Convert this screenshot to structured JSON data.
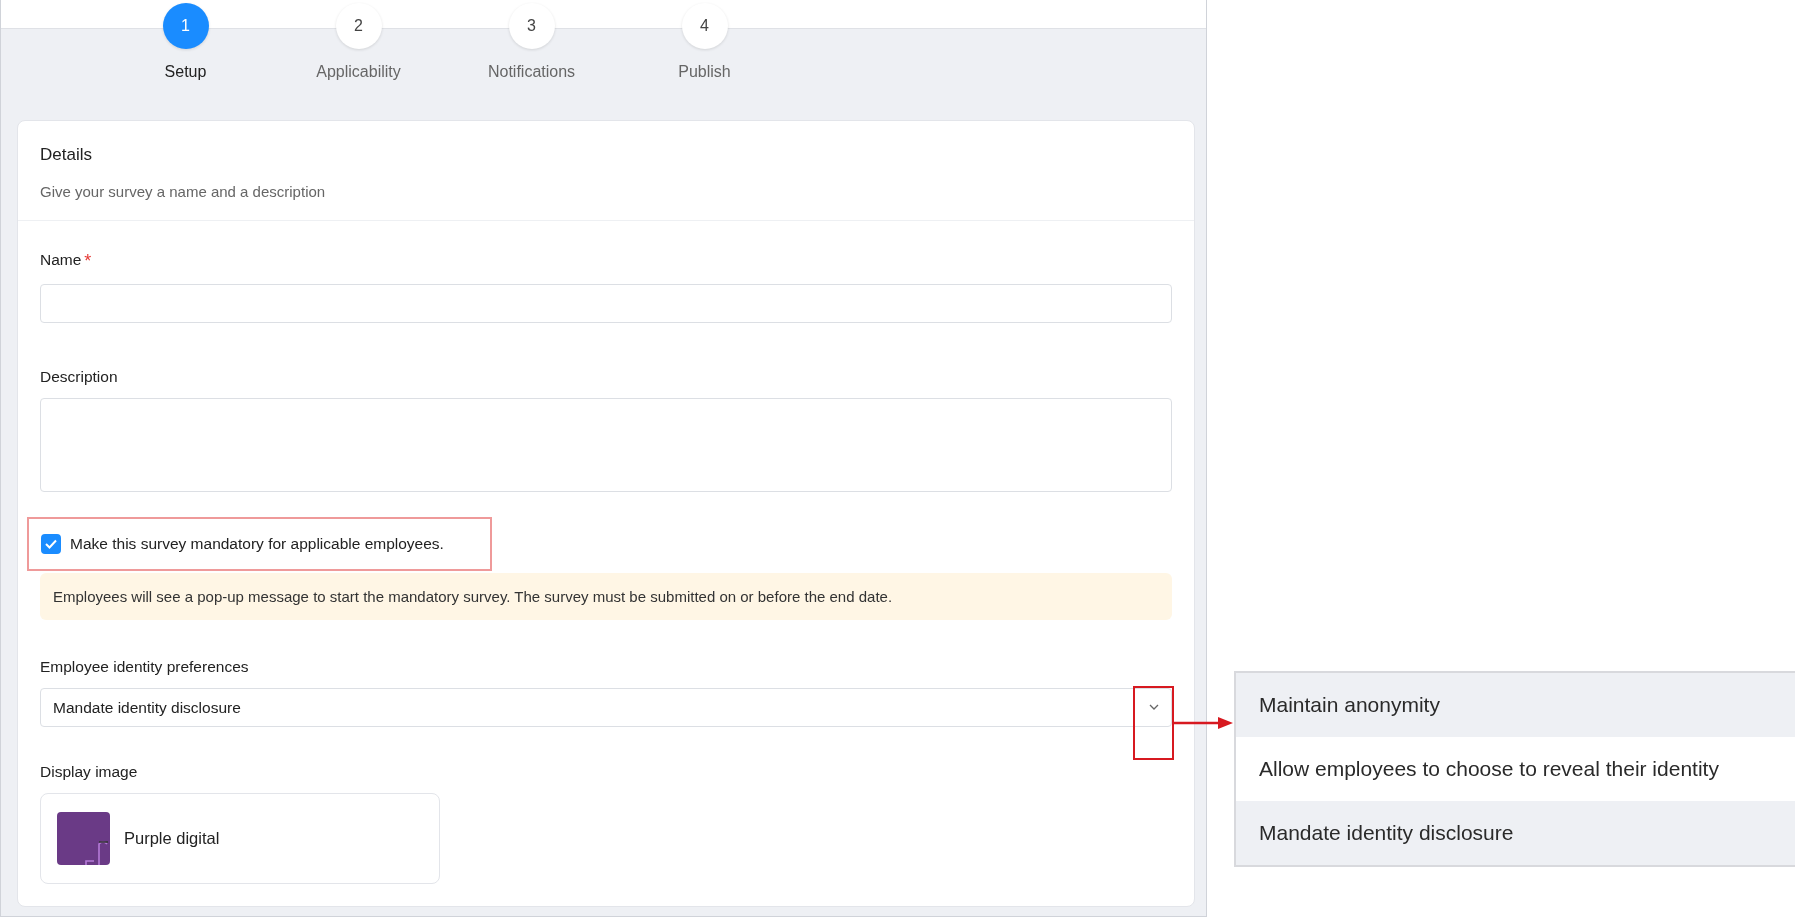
{
  "stepper": {
    "steps": [
      {
        "number": "1",
        "label": "Setup",
        "selected": true
      },
      {
        "number": "2",
        "label": "Applicability",
        "selected": false
      },
      {
        "number": "3",
        "label": "Notifications",
        "selected": false
      },
      {
        "number": "4",
        "label": "Publish",
        "selected": false
      }
    ]
  },
  "details": {
    "title": "Details",
    "subtitle": "Give your survey a name and a description"
  },
  "form": {
    "name_label": "Name",
    "name_required_mark": "*",
    "description_label": "Description",
    "mandatory_checkbox": {
      "label": "Make this survey mandatory for applicable employees.",
      "checked": true,
      "annotated": true
    },
    "info_banner": "Employees will see a pop-up message to start the mandatory survey. The survey must be submitted on or before the end date.",
    "identity_label": "Employee identity preferences",
    "identity_select": {
      "value": "Mandate identity disclosure",
      "annotated": true
    },
    "display_image_label": "Display image",
    "display_image": {
      "name": "Purple digital"
    }
  },
  "dropdown_options": [
    {
      "label": "Maintain anonymity",
      "shaded": true
    },
    {
      "label": "Allow employees to choose to reveal their identity",
      "shaded": false
    },
    {
      "label": "Mandate identity disclosure",
      "shaded": true
    }
  ]
}
